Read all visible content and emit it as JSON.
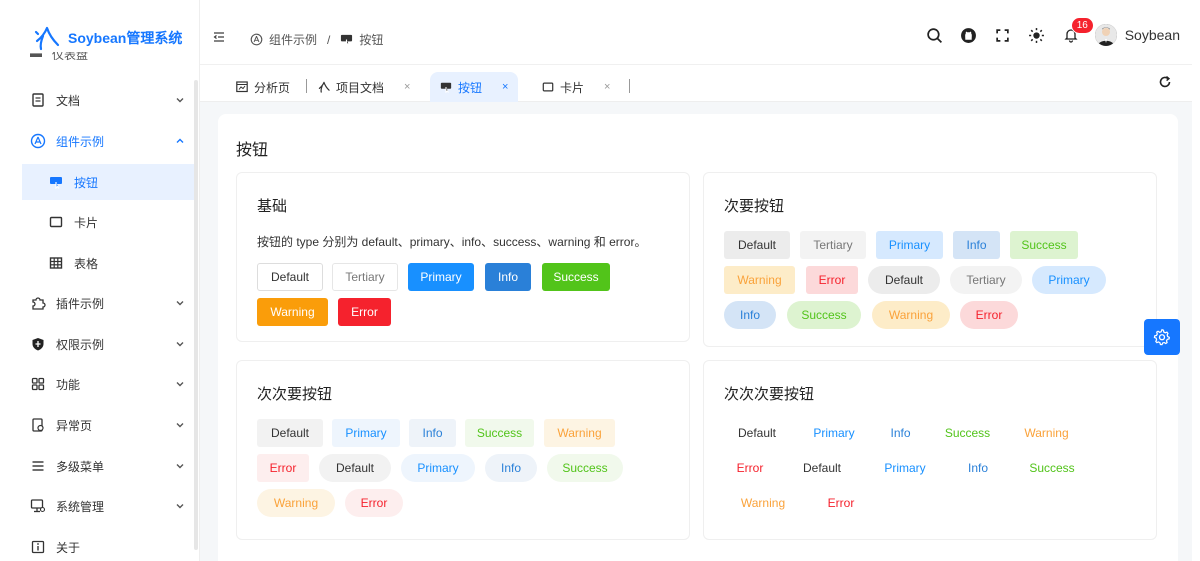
{
  "app": {
    "title": "Soybean管理系统"
  },
  "sidebar": {
    "partial_label": "仪表盘",
    "items": [
      {
        "label": "文档",
        "icon": "document-icon"
      },
      {
        "label": "组件示例",
        "icon": "components-icon"
      },
      {
        "label": "按钮",
        "icon": "button-icon"
      },
      {
        "label": "卡片",
        "icon": "card-icon"
      },
      {
        "label": "表格",
        "icon": "table-icon"
      },
      {
        "label": "插件示例",
        "icon": "plugin-icon"
      },
      {
        "label": "权限示例",
        "icon": "shield-icon"
      },
      {
        "label": "功能",
        "icon": "grid-icon"
      },
      {
        "label": "异常页",
        "icon": "exception-icon"
      },
      {
        "label": "多级菜单",
        "icon": "menu-lines-icon"
      },
      {
        "label": "系统管理",
        "icon": "monitor-icon"
      },
      {
        "label": "关于",
        "icon": "info-icon"
      }
    ]
  },
  "header": {
    "breadcrumb": [
      {
        "label": "组件示例"
      },
      {
        "label": "按钮"
      }
    ],
    "breadcrumb_separator": "/",
    "notification_count": "16",
    "username": "Soybean"
  },
  "tabs": [
    {
      "label": "分析页",
      "closable": false
    },
    {
      "label": "项目文档",
      "closable": true
    },
    {
      "label": "按钮",
      "closable": true,
      "active": true
    },
    {
      "label": "卡片",
      "closable": true
    }
  ],
  "close_glyph": "×",
  "main": {
    "title": "按钮",
    "basic": {
      "title": "基础",
      "description": "按钮的 type 分别为 default、primary、info、success、warning 和 error。",
      "buttons": [
        "Default",
        "Tertiary",
        "Primary",
        "Info",
        "Success",
        "Warning",
        "Error"
      ]
    },
    "secondary": {
      "title": "次要按钮",
      "buttons": [
        "Default",
        "Tertiary",
        "Primary",
        "Info",
        "Success",
        "Warning",
        "Error",
        "Default",
        "Tertiary",
        "Primary",
        "Info",
        "Success",
        "Warning",
        "Error"
      ]
    },
    "tertiary": {
      "title": "次次要按钮",
      "buttons": [
        "Default",
        "Primary",
        "Info",
        "Success",
        "Warning",
        "Error",
        "Default",
        "Primary",
        "Info",
        "Success",
        "Warning",
        "Error"
      ]
    },
    "quaternary": {
      "title": "次次次要按钮",
      "buttons": [
        "Default",
        "Primary",
        "Info",
        "Success",
        "Warning",
        "Error",
        "Default",
        "Primary",
        "Info",
        "Success",
        "Warning",
        "Error"
      ]
    }
  },
  "colors": {
    "primary": "#1890ff",
    "info": "#2a80d8",
    "success": "#52c41a",
    "warning": "#fa9d0a",
    "error": "#f5222d",
    "accent": "#1677ff"
  }
}
